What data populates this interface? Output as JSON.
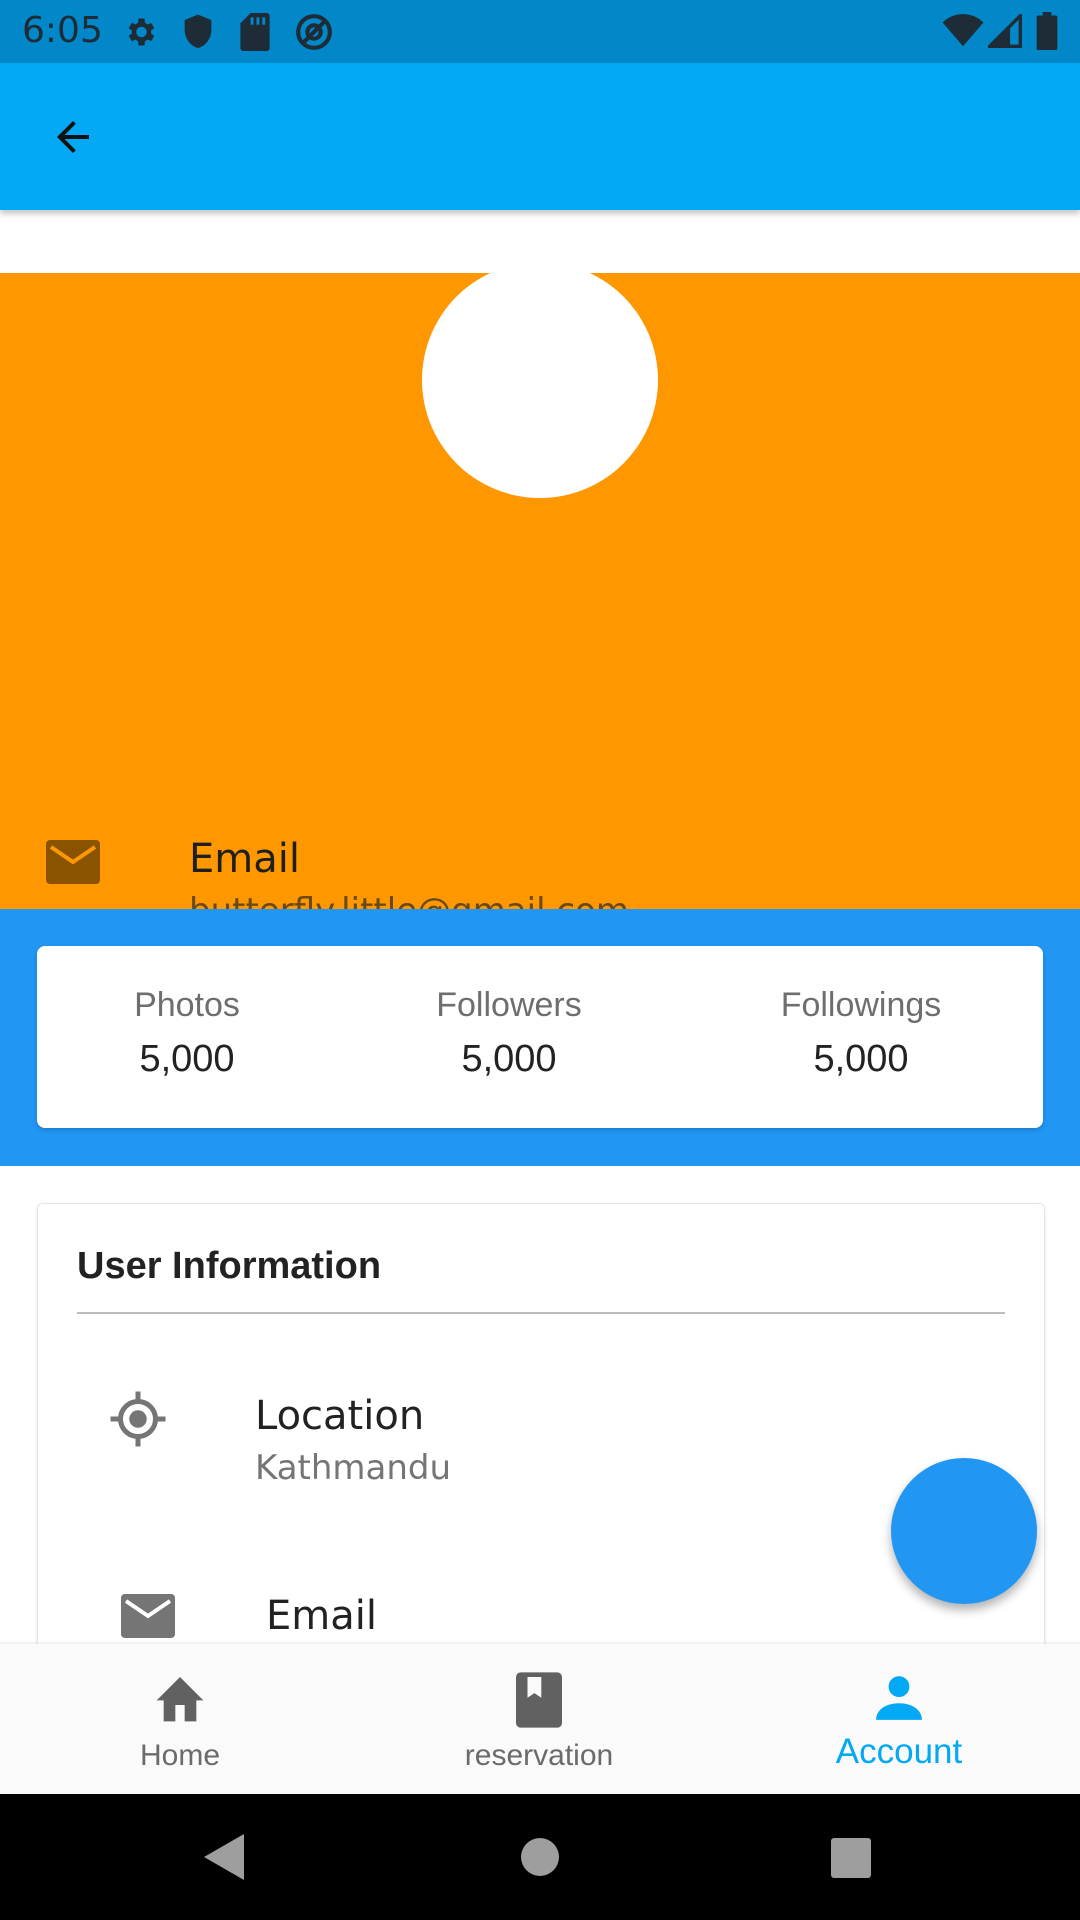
{
  "status_bar": {
    "time": "6:05",
    "icons": [
      "settings-icon",
      "shield-icon",
      "sd-card-icon",
      "at-sign-icon",
      "wifi-icon",
      "signal-icon",
      "battery-icon"
    ]
  },
  "app_bar": {
    "back_icon": "arrow-back-icon",
    "color": "#03a9f4"
  },
  "profile_header": {
    "color": "#ff9800",
    "email_title": "Email",
    "email_value": "butterfly.little@gmail.com"
  },
  "stats": {
    "color": "#2196f3",
    "items": [
      {
        "label": "Photos",
        "value": "5,000"
      },
      {
        "label": "Followers",
        "value": "5,000"
      },
      {
        "label": "Followings",
        "value": "5,000"
      }
    ]
  },
  "user_info": {
    "title": "User Information",
    "location_title": "Location",
    "location_value": "Kathmandu",
    "email_title": "Email"
  },
  "bottom_nav": {
    "items": [
      {
        "label": "Home",
        "icon": "home-icon",
        "active": false
      },
      {
        "label": "reservation",
        "icon": "book-icon",
        "active": false
      },
      {
        "label": "Account",
        "icon": "person-icon",
        "active": true
      }
    ],
    "active_color": "#03a9f4"
  }
}
